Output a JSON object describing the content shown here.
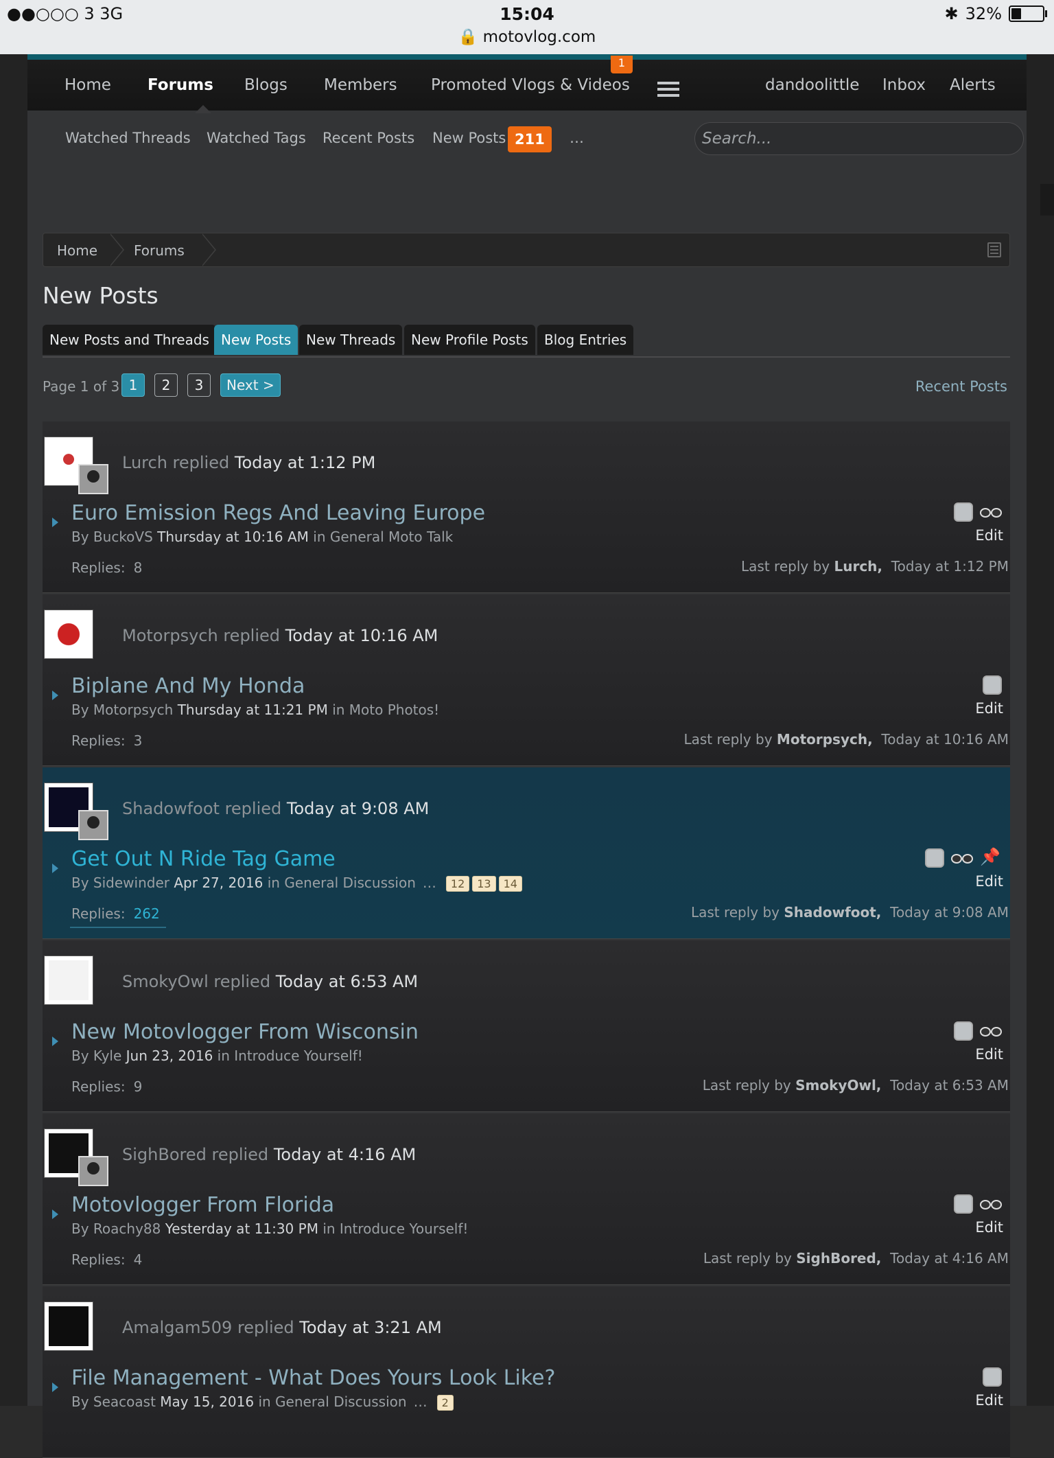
{
  "statusbar": {
    "carrier": "●●○○○ 3   3G",
    "time": "15:04",
    "url": "motovlog.com",
    "battery": "32%",
    "battery_level": 0.32
  },
  "nav": {
    "items": [
      "Home",
      "Forums",
      "Blogs",
      "Members",
      "Promoted Vlogs & Videos"
    ],
    "active": "Forums",
    "badge": "1",
    "right_items": [
      "dandoolittle",
      "Inbox",
      "Alerts"
    ]
  },
  "subnav": {
    "items": [
      "Watched Threads",
      "Watched Tags",
      "Recent Posts",
      "New Posts"
    ],
    "new_posts_count": "211",
    "more": "…",
    "search_placeholder": "Search..."
  },
  "breadcrumb": [
    "Home",
    "Forums"
  ],
  "page_title": "New Posts",
  "tabs": [
    "New Posts and Threads",
    "New Posts",
    "New Threads",
    "New Profile Posts",
    "Blog Entries"
  ],
  "active_tab": "New Posts",
  "pager": {
    "label": "Page 1 of 3",
    "pages": [
      "1",
      "2",
      "3"
    ],
    "current": "1",
    "next": "Next >",
    "recent_link": "Recent Posts"
  },
  "threads": [
    {
      "replier": "Lurch",
      "replied_word": "replied",
      "replied_at": "Today at 1:12 PM",
      "title": "Euro Emission Regs And Leaving Europe",
      "by_word": "By",
      "author": "BuckoVS",
      "started": "Thursday at 10:16 AM",
      "in_word": "in",
      "forum": "General Moto Talk",
      "replies_label": "Replies:",
      "replies": "8",
      "last_reply_label": "Last reply by",
      "last_reply_user": "Lurch,",
      "last_reply_time": "Today at 1:12 PM",
      "edit": "Edit",
      "watched": true,
      "sticky": false,
      "highlight": false
    },
    {
      "replier": "Motorpsych",
      "replied_word": "replied",
      "replied_at": "Today at 10:16 AM",
      "title": "Biplane And My Honda",
      "by_word": "By",
      "author": "Motorpsych",
      "started": "Thursday at 11:21 PM",
      "in_word": "in",
      "forum": "Moto Photos!",
      "replies_label": "Replies:",
      "replies": "3",
      "last_reply_label": "Last reply by",
      "last_reply_user": "Motorpsych,",
      "last_reply_time": "Today at 10:16 AM",
      "edit": "Edit",
      "watched": false,
      "sticky": false,
      "highlight": false
    },
    {
      "replier": "Shadowfoot",
      "replied_word": "replied",
      "replied_at": "Today at 9:08 AM",
      "title": "Get Out N Ride Tag Game",
      "by_word": "By",
      "author": "Sidewinder",
      "started": "Apr 27, 2016",
      "in_word": "in",
      "forum": "General Discussion",
      "page_ellipsis": "…",
      "page_links": [
        "12",
        "13",
        "14"
      ],
      "replies_label": "Replies:",
      "replies": "262",
      "last_reply_label": "Last reply by",
      "last_reply_user": "Shadowfoot,",
      "last_reply_time": "Today at 9:08 AM",
      "edit": "Edit",
      "watched": true,
      "sticky": true,
      "highlight": true
    },
    {
      "replier": "SmokyOwl",
      "replied_word": "replied",
      "replied_at": "Today at 6:53 AM",
      "title": "New Motovlogger From Wisconsin",
      "by_word": "By",
      "author": "Kyle",
      "started": "Jun 23, 2016",
      "in_word": "in",
      "forum": "Introduce Yourself!",
      "replies_label": "Replies:",
      "replies": "9",
      "last_reply_label": "Last reply by",
      "last_reply_user": "SmokyOwl,",
      "last_reply_time": "Today at 6:53 AM",
      "edit": "Edit",
      "watched": true,
      "sticky": false,
      "highlight": false
    },
    {
      "replier": "SighBored",
      "replied_word": "replied",
      "replied_at": "Today at 4:16 AM",
      "title": "Motovlogger From Florida",
      "by_word": "By",
      "author": "Roachy88",
      "started": "Yesterday at 11:30 PM",
      "in_word": "in",
      "forum": "Introduce Yourself!",
      "replies_label": "Replies:",
      "replies": "4",
      "last_reply_label": "Last reply by",
      "last_reply_user": "SighBored,",
      "last_reply_time": "Today at 4:16 AM",
      "edit": "Edit",
      "watched": true,
      "sticky": false,
      "highlight": false
    },
    {
      "replier": "Amalgam509",
      "replied_word": "replied",
      "replied_at": "Today at 3:21 AM",
      "title": "File Management - What Does Yours Look Like?",
      "by_word": "By",
      "author": "Seacoast",
      "started": "May 15, 2016",
      "in_word": "in",
      "forum": "General Discussion",
      "page_ellipsis": "…",
      "page_links": [
        "2"
      ],
      "edit": "Edit",
      "watched": false,
      "sticky": false,
      "highlight": false
    }
  ],
  "colors": {
    "accent": "#2a8ea7",
    "badge": "#ee6a12",
    "highlight_row": "#133b4c",
    "link": "#8fb1c0"
  }
}
